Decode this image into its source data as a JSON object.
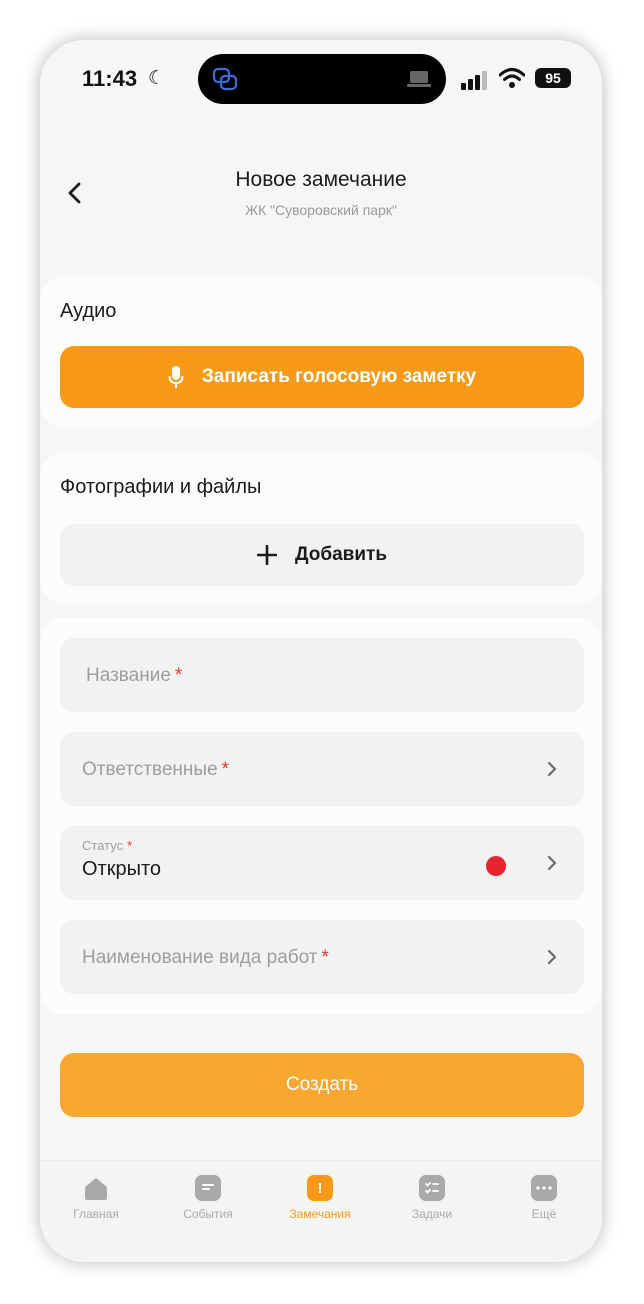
{
  "status_bar": {
    "time": "11:43",
    "battery": "95"
  },
  "header": {
    "title": "Новое замечание",
    "subtitle": "ЖК \"Суворовский парк\""
  },
  "audio": {
    "label": "Аудио",
    "record_button": "Записать голосовую заметку"
  },
  "photos": {
    "label": "Фотографии и файлы",
    "add_button": "Добавить"
  },
  "fields": {
    "name_placeholder": "Название",
    "responsible_placeholder": "Ответственные",
    "status_label": "Статус",
    "status_value": "Открыто",
    "work_type_placeholder": "Наименование вида работ",
    "required_mark": "*"
  },
  "colors": {
    "accent": "#f89a17",
    "status_open": "#e8242d"
  },
  "create_button": "Создать",
  "tabs": [
    {
      "label": "Главная",
      "icon": "home-icon"
    },
    {
      "label": "События",
      "icon": "events-icon"
    },
    {
      "label": "Замечания",
      "icon": "remarks-icon",
      "active": true
    },
    {
      "label": "Задачи",
      "icon": "tasks-icon"
    },
    {
      "label": "Ещё",
      "icon": "more-icon"
    }
  ]
}
